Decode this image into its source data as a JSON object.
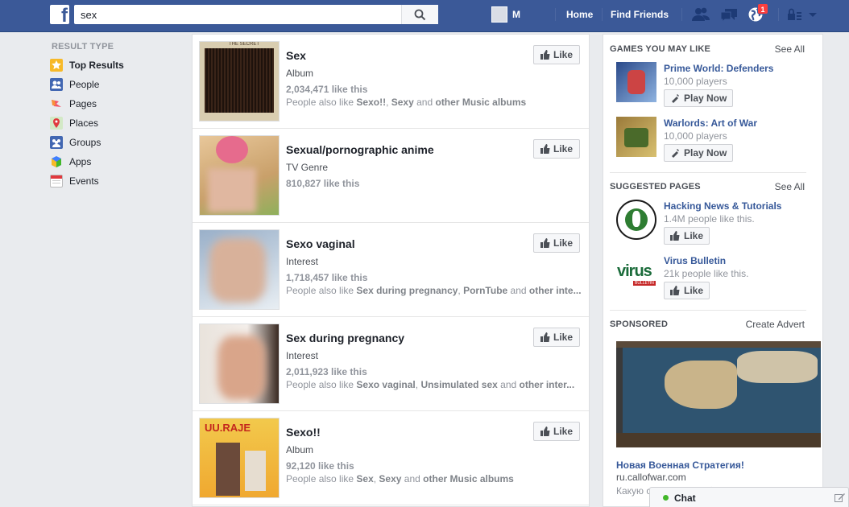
{
  "topbar": {
    "logo": "f",
    "search_value": "sex",
    "profile_name": "M",
    "nav": [
      "Home",
      "Find Friends"
    ],
    "notification_count": "1"
  },
  "left": {
    "heading": "RESULT TYPE",
    "filters": [
      {
        "label": "Top Results",
        "icon": "star-icon",
        "color": "#f7b928",
        "active": true
      },
      {
        "label": "People",
        "icon": "people-icon",
        "color": "#4267b2"
      },
      {
        "label": "Pages",
        "icon": "flag-icon",
        "color": "#f35369"
      },
      {
        "label": "Places",
        "icon": "map-pin-icon",
        "color": "#42b72a"
      },
      {
        "label": "Groups",
        "icon": "groups-icon",
        "color": "#4267b2"
      },
      {
        "label": "Apps",
        "icon": "apps-cube-icon",
        "color": "#4080ff"
      },
      {
        "label": "Events",
        "icon": "calendar-icon",
        "color": "#e0393e"
      }
    ]
  },
  "results": [
    {
      "title": "Sex",
      "category": "Album",
      "likes": "2,034,471 like this",
      "also_prefix": "People also like ",
      "also_parts": [
        "Sexo!!",
        ", ",
        "Sexy",
        " and ",
        "other Music albums"
      ],
      "like_label": "Like"
    },
    {
      "title": "Sexual/pornographic anime",
      "category": "TV Genre",
      "likes": "810,827 like this",
      "also_prefix": "",
      "also_parts": [],
      "like_label": "Like"
    },
    {
      "title": "Sexo vaginal",
      "category": "Interest",
      "likes": "1,718,457 like this",
      "also_prefix": "People also like ",
      "also_parts": [
        "Sex during pregnancy",
        ", ",
        "PornTube",
        " and ",
        "other inte..."
      ],
      "like_label": "Like"
    },
    {
      "title": "Sex during pregnancy",
      "category": "Interest",
      "likes": "2,011,923 like this",
      "also_prefix": "People also like ",
      "also_parts": [
        "Sexo vaginal",
        ", ",
        "Unsimulated sex",
        " and ",
        "other inter..."
      ],
      "like_label": "Like"
    },
    {
      "title": "Sexo!!",
      "category": "Album",
      "likes": "92,120 like this",
      "also_prefix": "People also like ",
      "also_parts": [
        "Sex",
        ", ",
        "Sexy",
        " and ",
        "other Music albums"
      ],
      "like_label": "Like"
    }
  ],
  "games": {
    "heading": "GAMES YOU MAY LIKE",
    "see_all": "See All",
    "items": [
      {
        "title": "Prime World: Defenders",
        "sub": "10,000 players",
        "button": "Play Now"
      },
      {
        "title": "Warlords: Art of War",
        "sub": "10,000 players",
        "button": "Play Now"
      }
    ]
  },
  "suggested": {
    "heading": "SUGGESTED PAGES",
    "see_all": "See All",
    "items": [
      {
        "title": "Hacking News & Tutorials",
        "sub": "1.4M people like this.",
        "button": "Like"
      },
      {
        "title": "Virus Bulletin",
        "sub": "21k people like this.",
        "button": "Like",
        "logo_text": "virus",
        "logo_sub": "BULLETIN"
      }
    ]
  },
  "sponsored": {
    "heading": "SPONSORED",
    "create": "Create Advert",
    "title": "Новая Военная Стратегия!",
    "url": "ru.callofwar.com",
    "desc": "Какую стратегию выбираете Вы? Сыграй"
  },
  "chat": {
    "label": "Chat"
  }
}
